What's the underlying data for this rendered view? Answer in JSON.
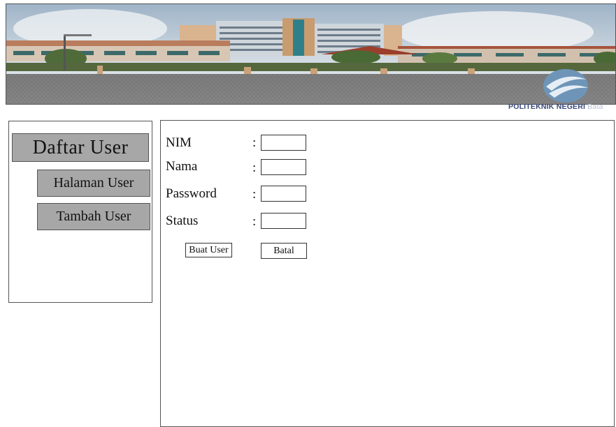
{
  "header": {
    "brand_main": "POLITEKNIK NEGERI",
    "brand_tail": "Bata"
  },
  "sidebar": {
    "title": "Daftar User",
    "items": [
      {
        "label": "Halaman User"
      },
      {
        "label": "Tambah User"
      }
    ]
  },
  "form": {
    "fields": [
      {
        "label": "NIM",
        "separator": ":",
        "value": ""
      },
      {
        "label": "Nama",
        "separator": ":",
        "value": ""
      },
      {
        "label": "Password",
        "separator": ":",
        "value": ""
      },
      {
        "label": "Status",
        "separator": ":",
        "value": ""
      }
    ],
    "submit_label": "Buat User",
    "cancel_label": "Batal"
  }
}
